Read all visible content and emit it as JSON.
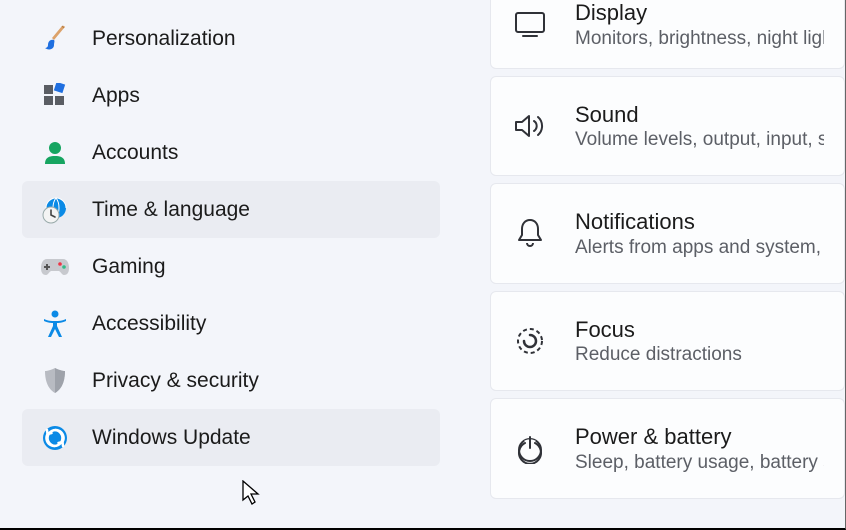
{
  "sidebar": {
    "items": [
      {
        "label": "Personalization"
      },
      {
        "label": "Apps"
      },
      {
        "label": "Accounts"
      },
      {
        "label": "Time & language"
      },
      {
        "label": "Gaming"
      },
      {
        "label": "Accessibility"
      },
      {
        "label": "Privacy & security"
      },
      {
        "label": "Windows Update"
      }
    ]
  },
  "main": {
    "cards": [
      {
        "title": "Display",
        "subtitle": "Monitors, brightness, night light,"
      },
      {
        "title": "Sound",
        "subtitle": "Volume levels, output, input, sour"
      },
      {
        "title": "Notifications",
        "subtitle": "Alerts from apps and system, do n"
      },
      {
        "title": "Focus",
        "subtitle": "Reduce distractions"
      },
      {
        "title": "Power & battery",
        "subtitle": "Sleep, battery usage, battery save"
      }
    ]
  }
}
